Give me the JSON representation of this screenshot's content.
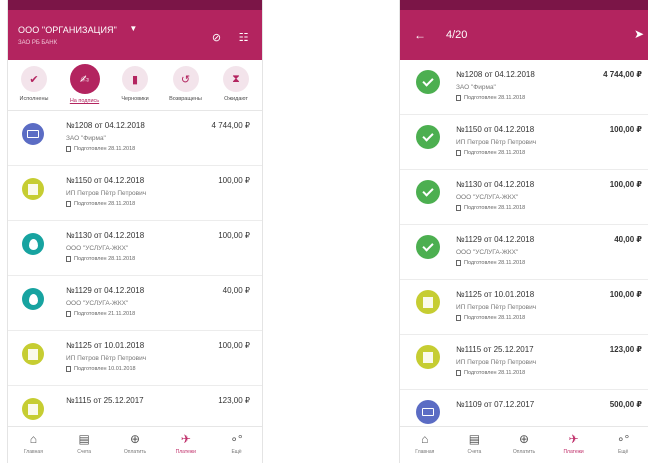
{
  "left": {
    "header": {
      "org_name": "ООО \"ОРГАНИЗАЦИЯ\"",
      "org_sub": "ЗАО РБ БАНК"
    },
    "tabs": [
      {
        "label": "Исполнены",
        "icon": "document-check-icon",
        "active": false
      },
      {
        "label": "На подпись",
        "icon": "signature-icon",
        "active": true
      },
      {
        "label": "Черновики",
        "icon": "draft-icon",
        "active": false
      },
      {
        "label": "Возвращены",
        "icon": "return-icon",
        "active": false
      },
      {
        "label": "Ожидают",
        "icon": "hourglass-icon",
        "active": false
      }
    ],
    "rows": [
      {
        "title": "№1208 от 04.12.2018",
        "amount": "4 744,00 ₽",
        "party": "ЗАО \"Фирма\"",
        "status": "Подготовлен 28.11.2018",
        "avatar": "card"
      },
      {
        "title": "№1150 от 04.12.2018",
        "amount": "100,00 ₽",
        "party": "ИП Петров Пётр Петрович",
        "status": "Подготовлен 28.11.2018",
        "avatar": "building"
      },
      {
        "title": "№1130 от 04.12.2018",
        "amount": "100,00 ₽",
        "party": "ООО \"УСЛУГА-ЖКХ\"",
        "status": "Подготовлен 28.11.2018",
        "avatar": "drop"
      },
      {
        "title": "№1129 от 04.12.2018",
        "amount": "40,00 ₽",
        "party": "ООО \"УСЛУГА-ЖКХ\"",
        "status": "Подготовлен 21.11.2018",
        "avatar": "drop"
      },
      {
        "title": "№1125 от 10.01.2018",
        "amount": "100,00 ₽",
        "party": "ИП Петров Пётр Петрович",
        "status": "Подготовлен 10.01.2018",
        "avatar": "building"
      },
      {
        "title": "№1115 от 25.12.2017",
        "amount": "123,00 ₽",
        "party": "",
        "status": "",
        "avatar": "building"
      }
    ],
    "nav": [
      {
        "label": "Главная",
        "icon": "home-icon",
        "glyph": "⌂",
        "active": false
      },
      {
        "label": "Счета",
        "icon": "accounts-icon",
        "glyph": "▤",
        "active": false
      },
      {
        "label": "Оплатить",
        "icon": "plus-circle-icon",
        "glyph": "⊕",
        "active": false
      },
      {
        "label": "Платежи",
        "icon": "paper-plane-icon",
        "glyph": "✈",
        "active": true
      },
      {
        "label": "Ещё",
        "icon": "more-icon",
        "glyph": "∘°",
        "active": false
      }
    ]
  },
  "right": {
    "header": {
      "counter": "4/20"
    },
    "rows": [
      {
        "title": "№1208 от 04.12.2018",
        "amount": "4 744,00 ₽",
        "party": "ЗАО \"Фирма\"",
        "status": "Подготовлен 28.11.2018",
        "avatar": "check"
      },
      {
        "title": "№1150 от 04.12.2018",
        "amount": "100,00 ₽",
        "party": "ИП Петров Пётр Петрович",
        "status": "Подготовлен 28.11.2018",
        "avatar": "check"
      },
      {
        "title": "№1130 от 04.12.2018",
        "amount": "100,00 ₽",
        "party": "ООО \"УСЛУГА-ЖКХ\"",
        "status": "Подготовлен 28.11.2018",
        "avatar": "check"
      },
      {
        "title": "№1129 от 04.12.2018",
        "amount": "40,00 ₽",
        "party": "ООО \"УСЛУГА-ЖКХ\"",
        "status": "Подготовлен 28.11.2018",
        "avatar": "check"
      },
      {
        "title": "№1125 от 10.01.2018",
        "amount": "100,00 ₽",
        "party": "ИП Петров Пётр Петрович",
        "status": "Подготовлен 28.11.2018",
        "avatar": "building"
      },
      {
        "title": "№1115 от 25.12.2017",
        "amount": "123,00 ₽",
        "party": "ИП Петров Пётр Петрович",
        "status": "Подготовлен 28.11.2018",
        "avatar": "building"
      },
      {
        "title": "№1109 от 07.12.2017",
        "amount": "500,00 ₽",
        "party": "",
        "status": "",
        "avatar": "card"
      }
    ],
    "nav": [
      {
        "label": "Главная",
        "icon": "home-icon",
        "glyph": "⌂",
        "active": false
      },
      {
        "label": "Счета",
        "icon": "accounts-icon",
        "glyph": "▤",
        "active": false
      },
      {
        "label": "Оплатить",
        "icon": "plus-circle-icon",
        "glyph": "⊕",
        "active": false
      },
      {
        "label": "Платежи",
        "icon": "paper-plane-icon",
        "glyph": "✈",
        "active": true
      },
      {
        "label": "Ещё",
        "icon": "more-icon",
        "glyph": "∘°",
        "active": false
      }
    ]
  }
}
